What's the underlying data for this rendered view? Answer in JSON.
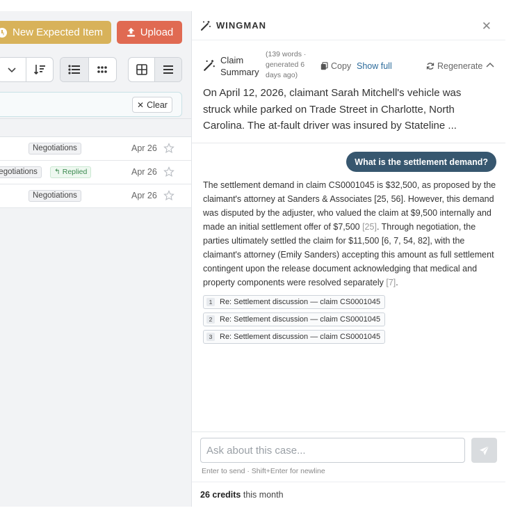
{
  "toolbar": {
    "new_expected_label": "New Expected Item",
    "upload_label": "Upload",
    "clear_label": "Clear"
  },
  "list": {
    "rows": [
      {
        "tag": "Negotiations",
        "replied": "",
        "date": "Apr 26"
      },
      {
        "tag": "Negotiations",
        "replied": "Replied",
        "date": "Apr 26"
      },
      {
        "tag": "Negotiations",
        "replied": "",
        "date": "Apr 26"
      }
    ]
  },
  "wingman": {
    "title": "WINGMAN",
    "summary": {
      "title": "Claim Summary",
      "meta": "(139 words · generated 6 days ago)",
      "copy_label": "Copy",
      "show_full_label": "Show full",
      "regenerate_label": "Regenerate",
      "text": "On April 12, 2026, claimant Sarah Mitchell's vehicle was struck while parked on Trade Street in Charlotte, North Carolina. The at-fault driver was insured by Stateline ..."
    },
    "question": "What is the settlement demand?",
    "answer": {
      "part1": "The settlement demand in claim CS0001045 is $32,500, as proposed by the claimant's attorney at Sanders & Associates [25, 56]. However, this demand was disputed by the adjuster, who valued the claim at $9,500 internally and made an initial settlement offer of $7,500 ",
      "cite1": "[25]",
      "part2": ". Through negotiation, the parties ultimately settled the claim for $11,500 [6, 7, 54, 82], with the claimant's attorney (Emily Sanders) accepting this amount as full settlement contingent upon the release document acknowledging that medical and property components were resolved separately ",
      "cite2": "[7]",
      "part3": "."
    },
    "sources": [
      {
        "num": "1",
        "label": "Re: Settlement discussion — claim CS0001045"
      },
      {
        "num": "2",
        "label": "Re: Settlement discussion — claim CS0001045"
      },
      {
        "num": "3",
        "label": "Re: Settlement discussion — claim CS0001045"
      }
    ],
    "input_placeholder": "Ask about this case...",
    "hint": "Enter to send · Shift+Enter for newline",
    "credits_value": "26 credits",
    "credits_suffix": "this month"
  }
}
